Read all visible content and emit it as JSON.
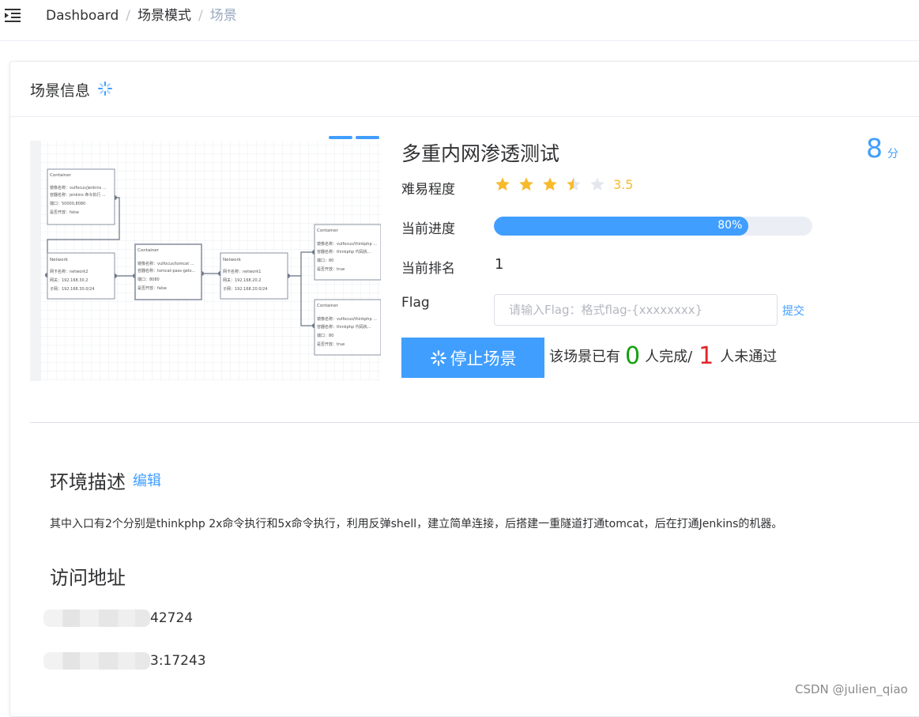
{
  "breadcrumb": {
    "items": [
      "Dashboard",
      "场景模式",
      "场景"
    ],
    "separator": "/"
  },
  "card": {
    "title": "场景信息"
  },
  "scene": {
    "title": "多重内网渗透测试",
    "score_value": "8",
    "score_unit": "分",
    "difficulty_label": "难易程度",
    "rating": 3.5,
    "rating_max": 5,
    "rating_text": "3.5",
    "progress_label": "当前进度",
    "progress_percent": 80,
    "progress_text": "80%",
    "rank_label": "当前排名",
    "rank_value": "1",
    "flag_label": "Flag",
    "flag_placeholder": "请输入Flag：格式flag-{xxxxxxxx}",
    "submit_label": "提交",
    "stop_button_label": "停止场景",
    "completion_prefix": "该场景已有",
    "completed_count": "0",
    "completed_suffix": "人完成/",
    "failed_count": "1",
    "failed_suffix": "人未通过"
  },
  "diagram": {
    "nodes": [
      {
        "title": "Container",
        "lines": [
          "镜像名称：vulfocus/jenkins ...",
          "容器名称：jenkins 命令执行 ...",
          "端口：50000,8080",
          "是否开放：false"
        ]
      },
      {
        "title": "Network",
        "lines": [
          "网卡名称：network2",
          "网关：192.168.30.2",
          "子网：192.168.30.0/24"
        ]
      },
      {
        "title": "Container",
        "lines": [
          "镜像名称：vulfocus/tomcat ...",
          "容器名称：tomcat-pass-gets...",
          "端口：8080",
          "是否开放：false"
        ]
      },
      {
        "title": "Network",
        "lines": [
          "网卡名称：network1",
          "网关：192.168.20.2",
          "子网：192.168.20.0/24"
        ]
      },
      {
        "title": "Container",
        "lines": [
          "镜像名称：vulfocus/thinkphp ...",
          "容器名称：thinkphp 代码执...",
          "端口：80",
          "是否开放：true"
        ]
      },
      {
        "title": "Container",
        "lines": [
          "镜像名称：vulfocus/thinkphp ...",
          "容器名称：thinkphp 代码执...",
          "端口：80",
          "是否开放：true"
        ]
      }
    ]
  },
  "environment": {
    "title": "环境描述",
    "edit_label": "编辑",
    "description": "其中入口有2个分别是thinkphp 2x命令执行和5x命令执行，利用反弹shell，建立简单连接，后搭建一重隧道打通tomcat，后在打通Jenkins的机器。"
  },
  "access": {
    "title": "访问地址",
    "addresses": [
      "42724",
      "3:17243"
    ]
  },
  "watermark": "CSDN @julien_qiao",
  "colors": {
    "primary": "#409eff",
    "star": "#f7ba2a",
    "green": "#13a10e",
    "red": "#e0262a"
  }
}
